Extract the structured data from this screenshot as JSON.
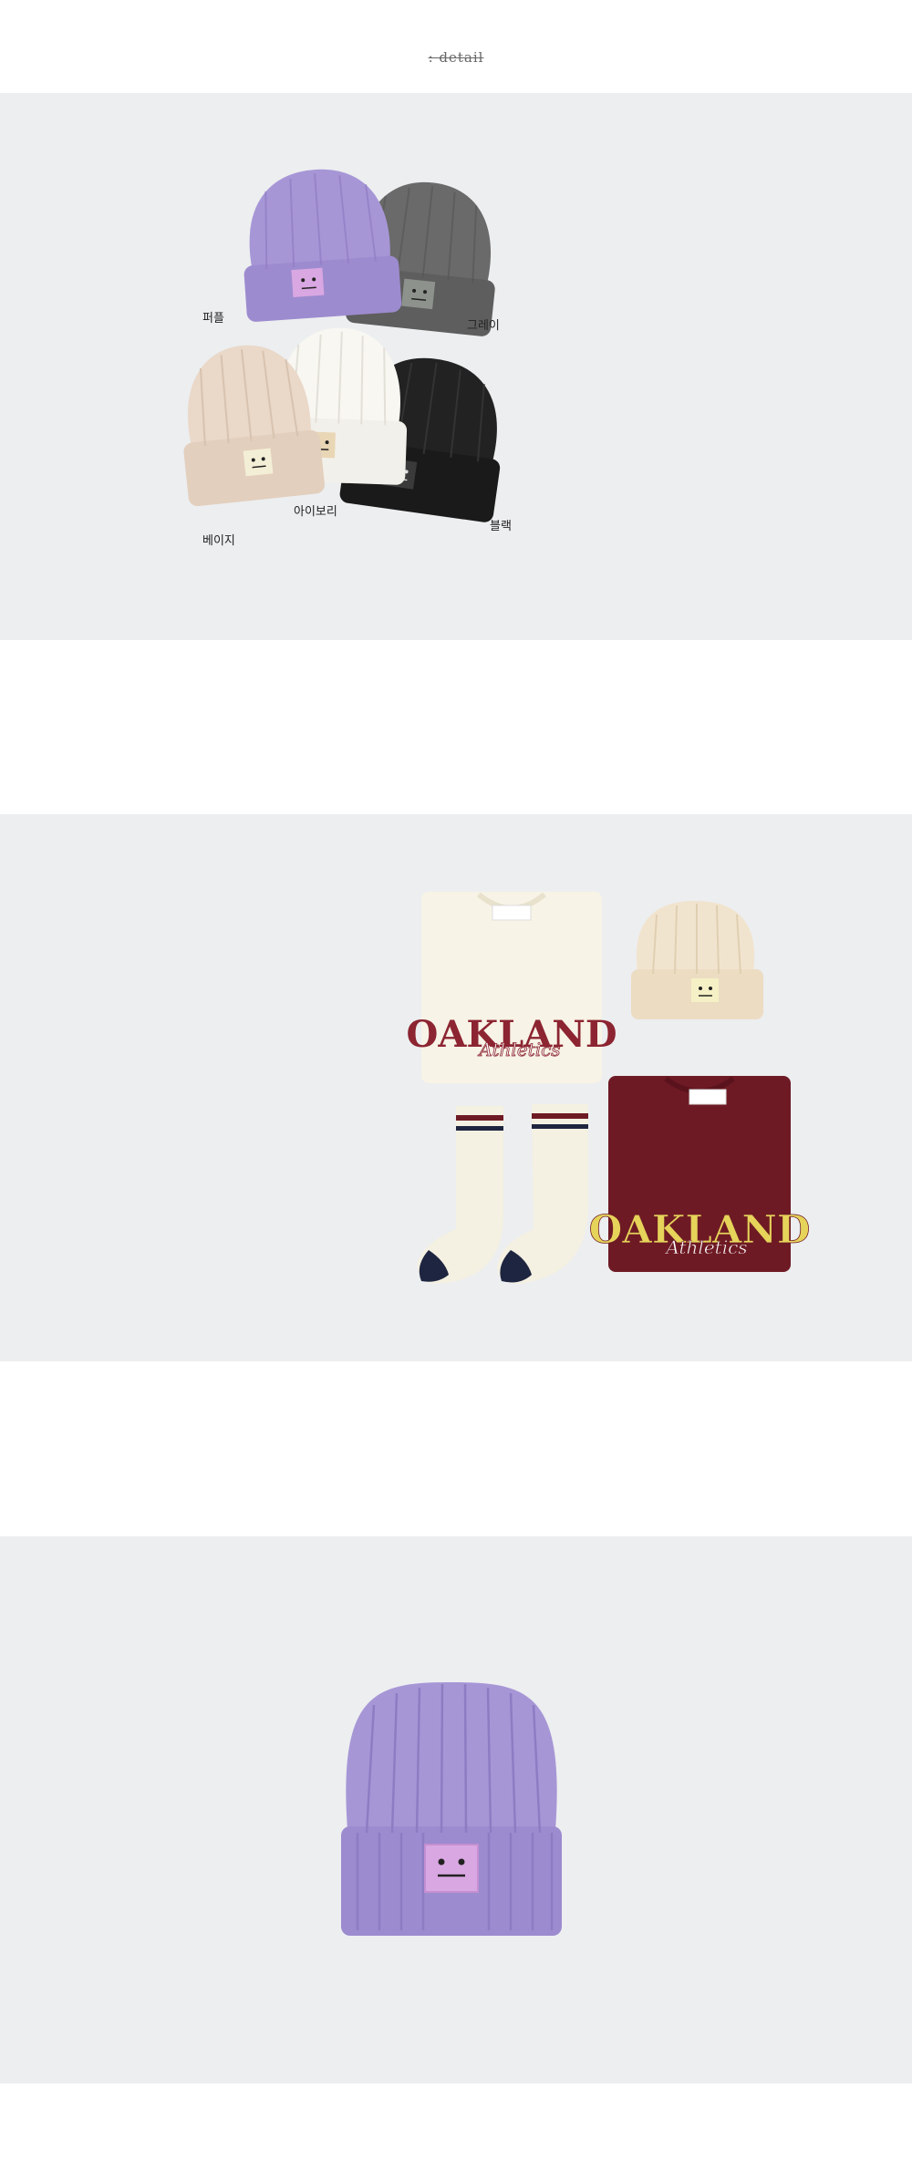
{
  "header": {
    "title": ": detail"
  },
  "colors": {
    "panel_bg": "#eceef0",
    "purple": "#a796d6",
    "grey": "#6a6a6a",
    "ivory": "#f7f5ef",
    "beige": "#e9d7c7",
    "black": "#1f1f1f",
    "burgundy": "#6e1a24",
    "mustard": "#e6d35a"
  },
  "section1": {
    "labels": {
      "purple": "퍼플",
      "grey": "그레이",
      "ivory": "아이보리",
      "beige": "베이지",
      "black": "블랙"
    }
  },
  "section2": {
    "sweatshirt_text": "OAKLAND",
    "sweatshirt_script": "Athletics"
  }
}
